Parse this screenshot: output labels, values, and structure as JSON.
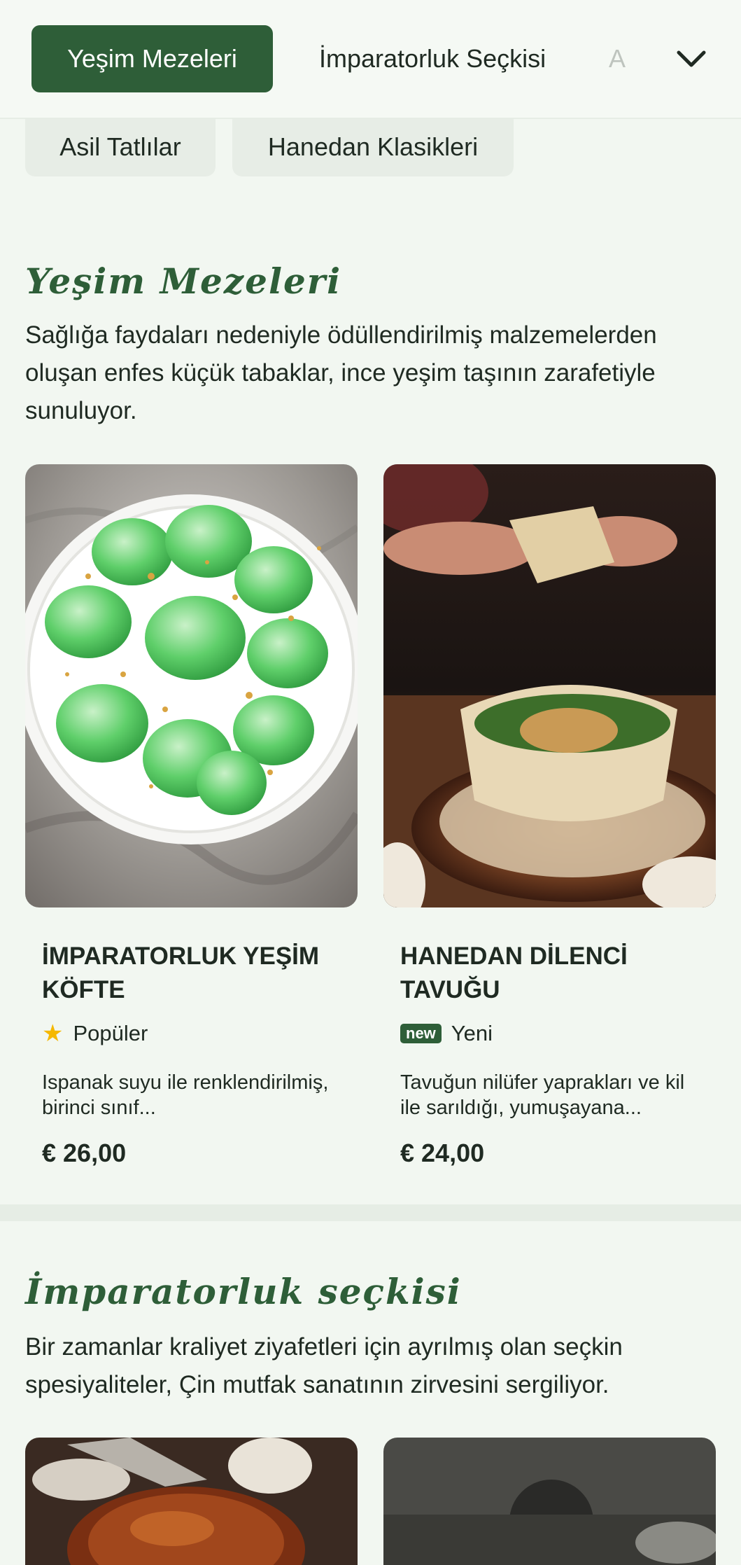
{
  "nav": {
    "tabs": [
      {
        "label": "Yeşim Mezeleri",
        "active": true
      },
      {
        "label": "İmparatorluk Seçkisi",
        "active": false
      },
      {
        "label": "A",
        "active": false
      }
    ],
    "chevron_icon": "chevron-down-icon"
  },
  "chips": [
    "Asil Tatlılar",
    "Hanedan Klasikleri"
  ],
  "sections": [
    {
      "title": "Yeşim Mezeleri",
      "description": "Sağlığa faydaları nedeniyle ödüllendirilmiş malzemelerden oluşan enfes küçük tabaklar, ince yeşim taşının zarafetiyle sunuluyor.",
      "items": [
        {
          "name": "İMPARATORLUK YEŞİM KÖFTE",
          "badge_label": "Popüler",
          "badge_icon": "star-icon",
          "description": "Ispanak suyu ile renklendirilmiş, birinci sınıf...",
          "price": "€ 26,00"
        },
        {
          "name": "HANEDAN DİLENCİ TAVUĞU",
          "badge_tag": "new",
          "badge_label": "Yeni",
          "description": "Tavuğun nilüfer yaprakları ve kil ile sarıldığı, yumuşayana...",
          "price": "€ 24,00"
        }
      ]
    },
    {
      "title": "İmparatorluk seçkisi",
      "description": "Bir zamanlar kraliyet ziyafetleri için ayrılmış olan seçkin spesiyaliteler, Çin mutfak sanatının zirvesini sergiliyor."
    }
  ],
  "colors": {
    "accent": "#2e5e38",
    "background": "#f2f7f1",
    "star": "#f5b800"
  }
}
